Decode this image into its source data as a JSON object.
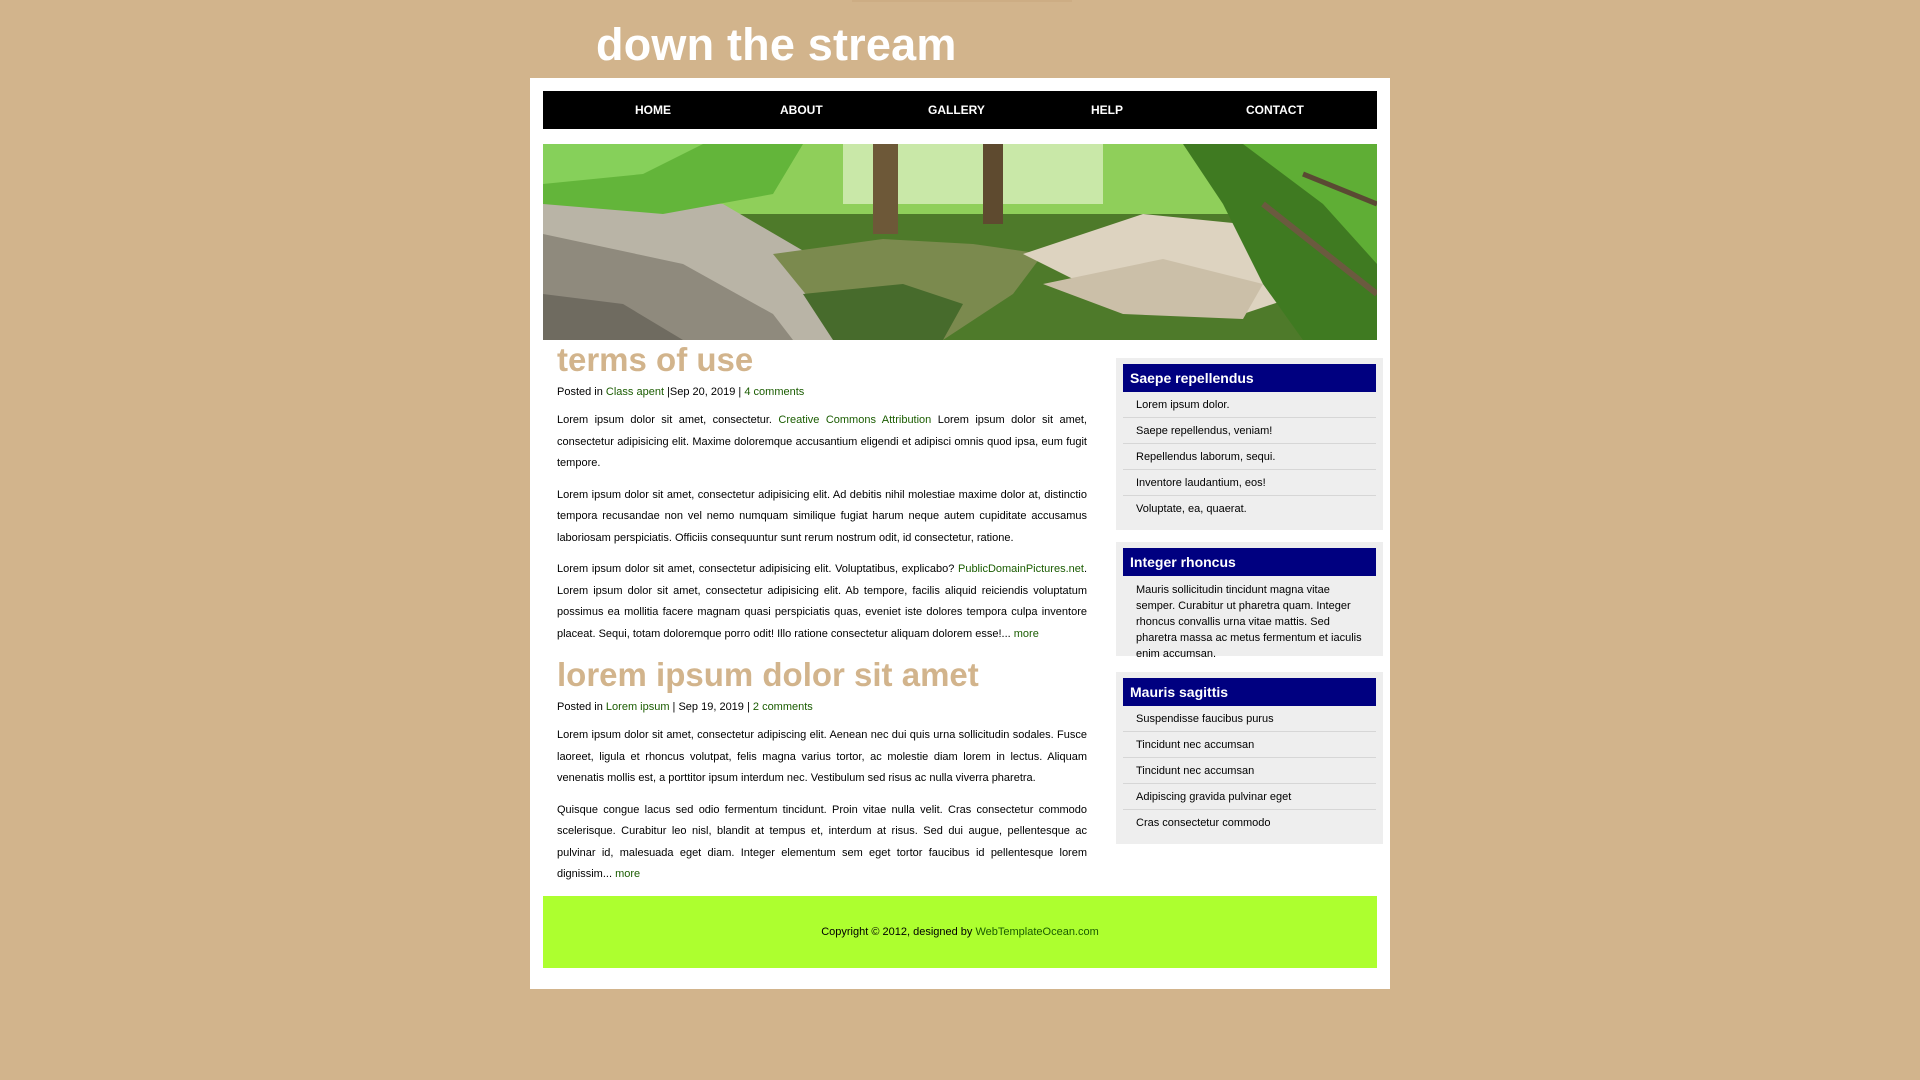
{
  "site": {
    "title": "down the stream"
  },
  "nav": {
    "items": [
      "HOME",
      "ABOUT",
      "GALLERY",
      "HELP",
      "CONTACT"
    ]
  },
  "posts": [
    {
      "title": "terms of use",
      "meta_prefix": "Posted in ",
      "category": "Class apent",
      "date": " |Sep 20, 2019 | ",
      "comments": "4 comments",
      "paragraphs": [
        {
          "before": "Lorem ipsum dolor sit amet, consectetur. ",
          "link": "Creative Commons Attribution",
          "after": " Lorem ipsum dolor sit amet, consectetur adipisicing elit. Maxime doloremque accusantium eligendi et adipisci omnis quod ipsa, eum fugit tempore."
        },
        {
          "before": "Lorem ipsum dolor sit amet, consectetur adipisicing elit. Ad debitis nihil molestiae maxime dolor at, distinctio tempora recusandae non vel nemo numquam similique fugiat harum neque autem cupiditate accusamus laboriosam perspiciatis. Officiis consequuntur sunt rerum nostrum odit, id consectetur, ratione.",
          "link": "",
          "after": ""
        },
        {
          "before": "Lorem ipsum dolor sit amet, consectetur adipisicing elit. Voluptatibus, explicabo? ",
          "link": "PublicDomainPictures.net",
          "after": ". Lorem ipsum dolor sit amet, consectetur adipisicing elit. Ab tempore, facilis aliquid reiciendis voluptatum possimus ea mollitia facere magnam quasi perspiciatis quas, eveniet iste dolores tempora culpa inventore placeat. Sequi, totam doloremque porro odit! Illo ratione consectetur aliquam dolorem esse!... ",
          "more": "more"
        }
      ]
    },
    {
      "title": "lorem ipsum dolor sit amet",
      "meta_prefix": "Posted in ",
      "category": "Lorem ipsum",
      "date": " | Sep 19, 2019 | ",
      "comments": "2 comments",
      "paragraphs": [
        {
          "before": "Lorem ipsum dolor sit amet, consectetur adipiscing elit. Aenean nec dui quis urna sollicitudin sodales. Fusce laoreet, ligula et rhoncus volutpat, felis magna varius tortor, ac molestie diam lorem in lectus. Aliquam venenatis mollis est, a porttitor ipsum interdum nec. Vestibulum sed risus ac nulla viverra pharetra.",
          "link": "",
          "after": ""
        },
        {
          "before": "Quisque congue lacus sed odio fermentum tincidunt. Proin vitae nulla velit. Cras consectetur commodo scelerisque. Curabitur leo nisl, blandit at tempus et, interdum at risus. Sed dui augue, pellentesque ac pulvinar id, malesuada eget diam. Integer elementum sem eget tortor faucibus id pellentesque lorem dignissim... ",
          "more": "more"
        }
      ]
    }
  ],
  "sidebar": {
    "widget1": {
      "title": "Saepe repellendus",
      "items": [
        "Lorem ipsum dolor.",
        "Saepe repellendus, veniam!",
        "Repellendus laborum, sequi.",
        "Inventore laudantium, eos!",
        "Voluptate, ea, quaerat."
      ]
    },
    "widget2": {
      "title": "Integer rhoncus",
      "text": "Mauris sollicitudin tincidunt magna vitae semper. Curabitur ut pharetra quam. Integer rhoncus convallis urna vitae mattis. Sed pharetra massa ac metus fermentum et iaculis enim accumsan."
    },
    "widget3": {
      "title": "Mauris sagittis",
      "items": [
        "Suspendisse faucibus purus",
        "Tincidunt nec accumsan",
        "Tincidunt nec accumsan",
        "Adipiscing gravida pulvinar eget",
        "Cras consectetur commodo"
      ]
    }
  },
  "footer": {
    "copyright": "Copyright © 2012, designed by ",
    "designer": "WebTemplateOcean.com"
  },
  "colors": {
    "background": "#d2b48c",
    "nav": "#000000",
    "widget_header": "#000080",
    "footer": "#adff2f",
    "link": "#1a5c00",
    "post_title": "#d2b48c"
  }
}
